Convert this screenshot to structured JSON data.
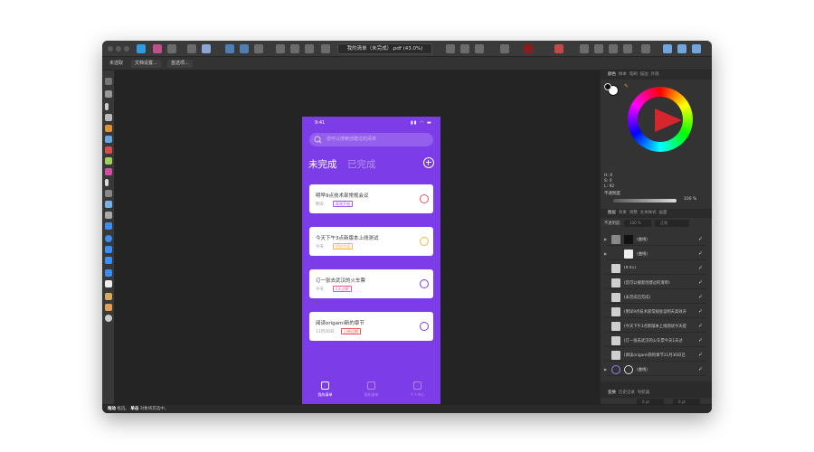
{
  "app": {
    "document_tab": "我的清单（未完成）.pdf (43.0%)",
    "context_bar": [
      "未选取",
      "文档设置...",
      "首选项..."
    ],
    "status_bar": {
      "bold1": "拖动",
      "t1": "框选。",
      "bold2": "单击",
      "t2": "对象将其选中。"
    }
  },
  "phone": {
    "time": "9:41",
    "search_placeholder": "您可以搜索创建过的清单",
    "tab_active": "未完成",
    "tab_inactive": "已完成",
    "tasks": [
      {
        "title": "明早9点技术部常规会议",
        "meta": "明天",
        "tag": "高效开始",
        "ring": "#e8505b",
        "tag_color": "#9b59e8"
      },
      {
        "title": "今天下午3点新版本上线测试",
        "meta": "今天",
        "tag": "提前完成",
        "ring": "#f5b540",
        "tag_color": "#f5b540"
      },
      {
        "title": "订一张去武汉的火车票",
        "meta": "今天",
        "tag": "1天过期",
        "ring": "#7c3ce8",
        "tag_color": "#e85aa0"
      },
      {
        "title": "阅读origami新的章节",
        "meta": "11月30日",
        "tag": "已经过期",
        "ring": "#7c3ce8",
        "tag_color": "#e8505b"
      }
    ],
    "bottom_nav": [
      "我的清单",
      "我的清单",
      "个人中心"
    ]
  },
  "panel": {
    "color_tabs": [
      "颜色",
      "样本",
      "笔刷",
      "描边",
      "外观"
    ],
    "hsl": [
      "H: 0",
      "S: 0",
      "L: 92"
    ],
    "opacity_label": "不透明度",
    "opacity_value": "100 %",
    "layer_tabs": [
      "图层",
      "效果",
      "调整",
      "文本样式",
      "画面"
    ],
    "layer_opacity_label": "不透明度:",
    "layer_opacity_value": "100 %",
    "blend_mode": "正常",
    "layers": [
      "(曲线)",
      "(曲线)",
      "(9:41)",
      "(您可以搜索创建过的清单)",
      "(未完成已完成)",
      "(明早9点技术部常规会议明天高效开",
      "(今天下午3点新版本上线测试今天提",
      "(订一张去武汉的火车票今天1天过",
      "(阅读origami新的章节11月30日已",
      "(曲线)"
    ],
    "transform_tabs": [
      "变换",
      "历史记录",
      "导航器"
    ],
    "transform_fields": {
      "x": "0 pt",
      "y": "0 pt",
      "w": "0 pt",
      "h": "0 pt",
      "r": "0 °",
      "s": "0 °"
    }
  }
}
